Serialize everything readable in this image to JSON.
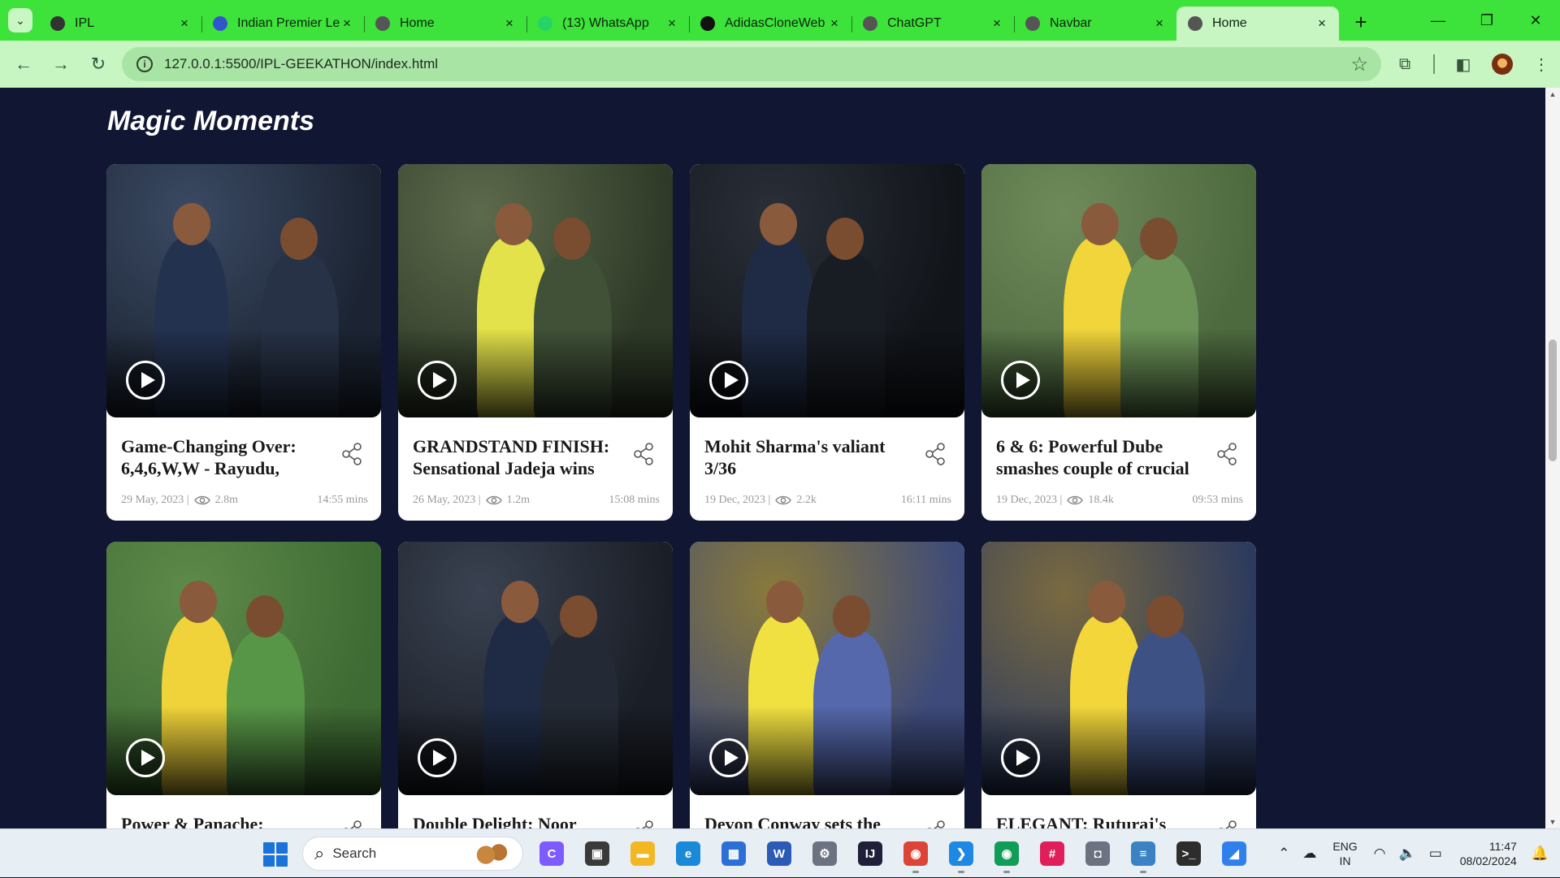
{
  "browser": {
    "tabs": [
      {
        "title": "IPL",
        "icon": "ipl-icon",
        "color": "#333"
      },
      {
        "title": "Indian Premier League",
        "icon": "ipl-flame-icon",
        "color": "#3355cc"
      },
      {
        "title": "Home",
        "icon": "globe-icon",
        "color": "#555"
      },
      {
        "title": "(13) WhatsApp",
        "icon": "whatsapp-icon",
        "color": "#25d366"
      },
      {
        "title": "AdidasCloneWeb",
        "icon": "github-icon",
        "color": "#111"
      },
      {
        "title": "ChatGPT",
        "icon": "chatgpt-icon",
        "color": "#555"
      },
      {
        "title": "Navbar",
        "icon": "globe-icon",
        "color": "#555"
      },
      {
        "title": "Home",
        "icon": "globe-icon",
        "color": "#555",
        "active": true
      }
    ],
    "url": "127.0.0.1:5500/IPL-GEEKATHON/index.html"
  },
  "page": {
    "section_title": "Magic Moments",
    "cards": [
      {
        "title": "Game-Changing Over: 6,4,6,W,W - Rayudu,",
        "date": "29 May, 2023 |",
        "views": "2.8m",
        "duration": "14:55 mins",
        "palette": [
          "#3a4a63",
          "#1c2433",
          "#23324f"
        ]
      },
      {
        "title": "GRANDSTAND FINISH: Sensational Jadeja wins",
        "date": "26 May, 2023 |",
        "views": "1.2m",
        "duration": "15:08 mins",
        "palette": [
          "#5d6a4c",
          "#2e3a27",
          "#e3e24a"
        ]
      },
      {
        "title": "Mohit Sharma's valiant 3/36",
        "date": "19 Dec, 2023 |",
        "views": "2.2k",
        "duration": "16:11 mins",
        "palette": [
          "#2a2f38",
          "#111419",
          "#1f2b45"
        ]
      },
      {
        "title": "6 & 6: Powerful Dube smashes couple of crucial",
        "date": "19 Dec, 2023 |",
        "views": "18.4k",
        "duration": "09:53 mins",
        "palette": [
          "#6f8a5a",
          "#4d6a3f",
          "#f1d53a"
        ]
      },
      {
        "title": "Power & Panache:",
        "date": "",
        "views": "",
        "duration": "",
        "palette": [
          "#5e8a4a",
          "#3e6b33",
          "#f0d33a"
        ]
      },
      {
        "title": "Double Delight: Noor",
        "date": "",
        "views": "",
        "duration": "",
        "palette": [
          "#3a4251",
          "#1a1e26",
          "#1f2b45"
        ]
      },
      {
        "title": "Devon Conway sets the",
        "date": "",
        "views": "",
        "duration": "",
        "palette": [
          "#8a7a3a",
          "#3d4a7a",
          "#f0e040"
        ]
      },
      {
        "title": "ELEGANT: Ruturaj's",
        "date": "",
        "views": "",
        "duration": "",
        "palette": [
          "#7a6a40",
          "#2c3a5e",
          "#f2d63a"
        ]
      }
    ]
  },
  "taskbar": {
    "search_label": "Search",
    "apps": [
      {
        "name": "copilot-icon",
        "color": "#7c5cff",
        "glyph": "C"
      },
      {
        "name": "task-view-icon",
        "color": "#3a3a3a",
        "glyph": "▣"
      },
      {
        "name": "file-explorer-icon",
        "color": "#f2b824",
        "glyph": "▬"
      },
      {
        "name": "edge-icon",
        "color": "#1a8ad8",
        "glyph": "e"
      },
      {
        "name": "microsoft-store-icon",
        "color": "#2c6fd6",
        "glyph": "▦"
      },
      {
        "name": "word-icon",
        "color": "#2b5bb5",
        "glyph": "W"
      },
      {
        "name": "settings-icon",
        "color": "#6b7280",
        "glyph": "⚙"
      },
      {
        "name": "intellij-icon",
        "color": "#1f1f3a",
        "glyph": "IJ"
      },
      {
        "name": "chrome-icon",
        "color": "#db4437",
        "glyph": "◉",
        "running": true
      },
      {
        "name": "vscode-icon",
        "color": "#1e88e5",
        "glyph": "❯",
        "running": true
      },
      {
        "name": "chrome-profile-icon",
        "color": "#0f9d58",
        "glyph": "◉",
        "running": true
      },
      {
        "name": "slack-icon",
        "color": "#e01e5a",
        "glyph": "#"
      },
      {
        "name": "camera-icon",
        "color": "#6b7280",
        "glyph": "◘"
      },
      {
        "name": "notepad-icon",
        "color": "#3b82c4",
        "glyph": "≡",
        "running": true
      },
      {
        "name": "terminal-icon",
        "color": "#2d2d2d",
        "glyph": ">_"
      },
      {
        "name": "files-icon",
        "color": "#2f80ed",
        "glyph": "◢"
      }
    ],
    "lang_top": "ENG",
    "lang_bottom": "IN",
    "time": "11:47",
    "date": "08/02/2024"
  }
}
